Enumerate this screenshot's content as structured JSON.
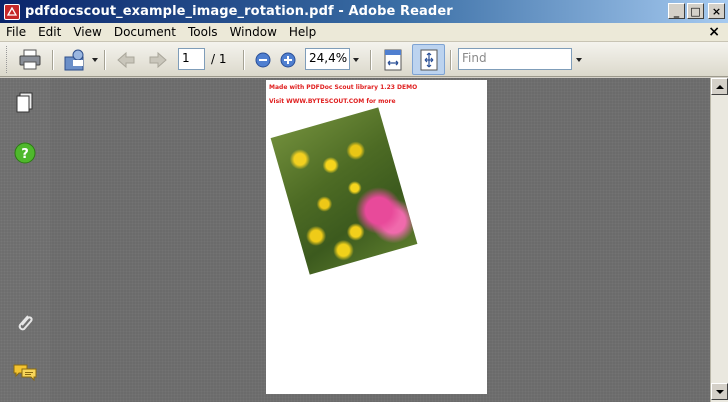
{
  "window": {
    "title": "pdfdocscout_example_image_rotation.pdf - Adobe Reader",
    "min_glyph": "_",
    "max_glyph": "□",
    "close_glyph": "×"
  },
  "menubar": {
    "items": [
      "File",
      "Edit",
      "View",
      "Document",
      "Tools",
      "Window",
      "Help"
    ],
    "close_glyph": "×"
  },
  "toolbar": {
    "page_current": "1",
    "page_total": "/ 1",
    "zoom": "24,4%",
    "find_placeholder": "Find"
  },
  "document": {
    "demo_line_1": "Made with PDFDoc Scout library 1.23 DEMO",
    "demo_line_2": "Visit WWW.BYTESCOUT.COM for more"
  },
  "colors": {
    "accent_red": "#e02020",
    "titlebar_start": "#0a246a",
    "titlebar_end": "#a6caf0",
    "workspace": "#6b6b6b"
  },
  "icons": {
    "app": "acrobat-icon",
    "print": "printer-icon",
    "share": "collaborate-icon",
    "prev": "previous-page-icon",
    "next": "next-page-icon",
    "zoom_out": "zoom-out-icon",
    "zoom_in": "zoom-in-icon",
    "fit_width": "fit-width-icon",
    "fit_page": "fit-page-icon",
    "pages": "pages-icon",
    "help": "help-icon",
    "attachments": "paperclip-icon",
    "comments": "comments-icon"
  }
}
